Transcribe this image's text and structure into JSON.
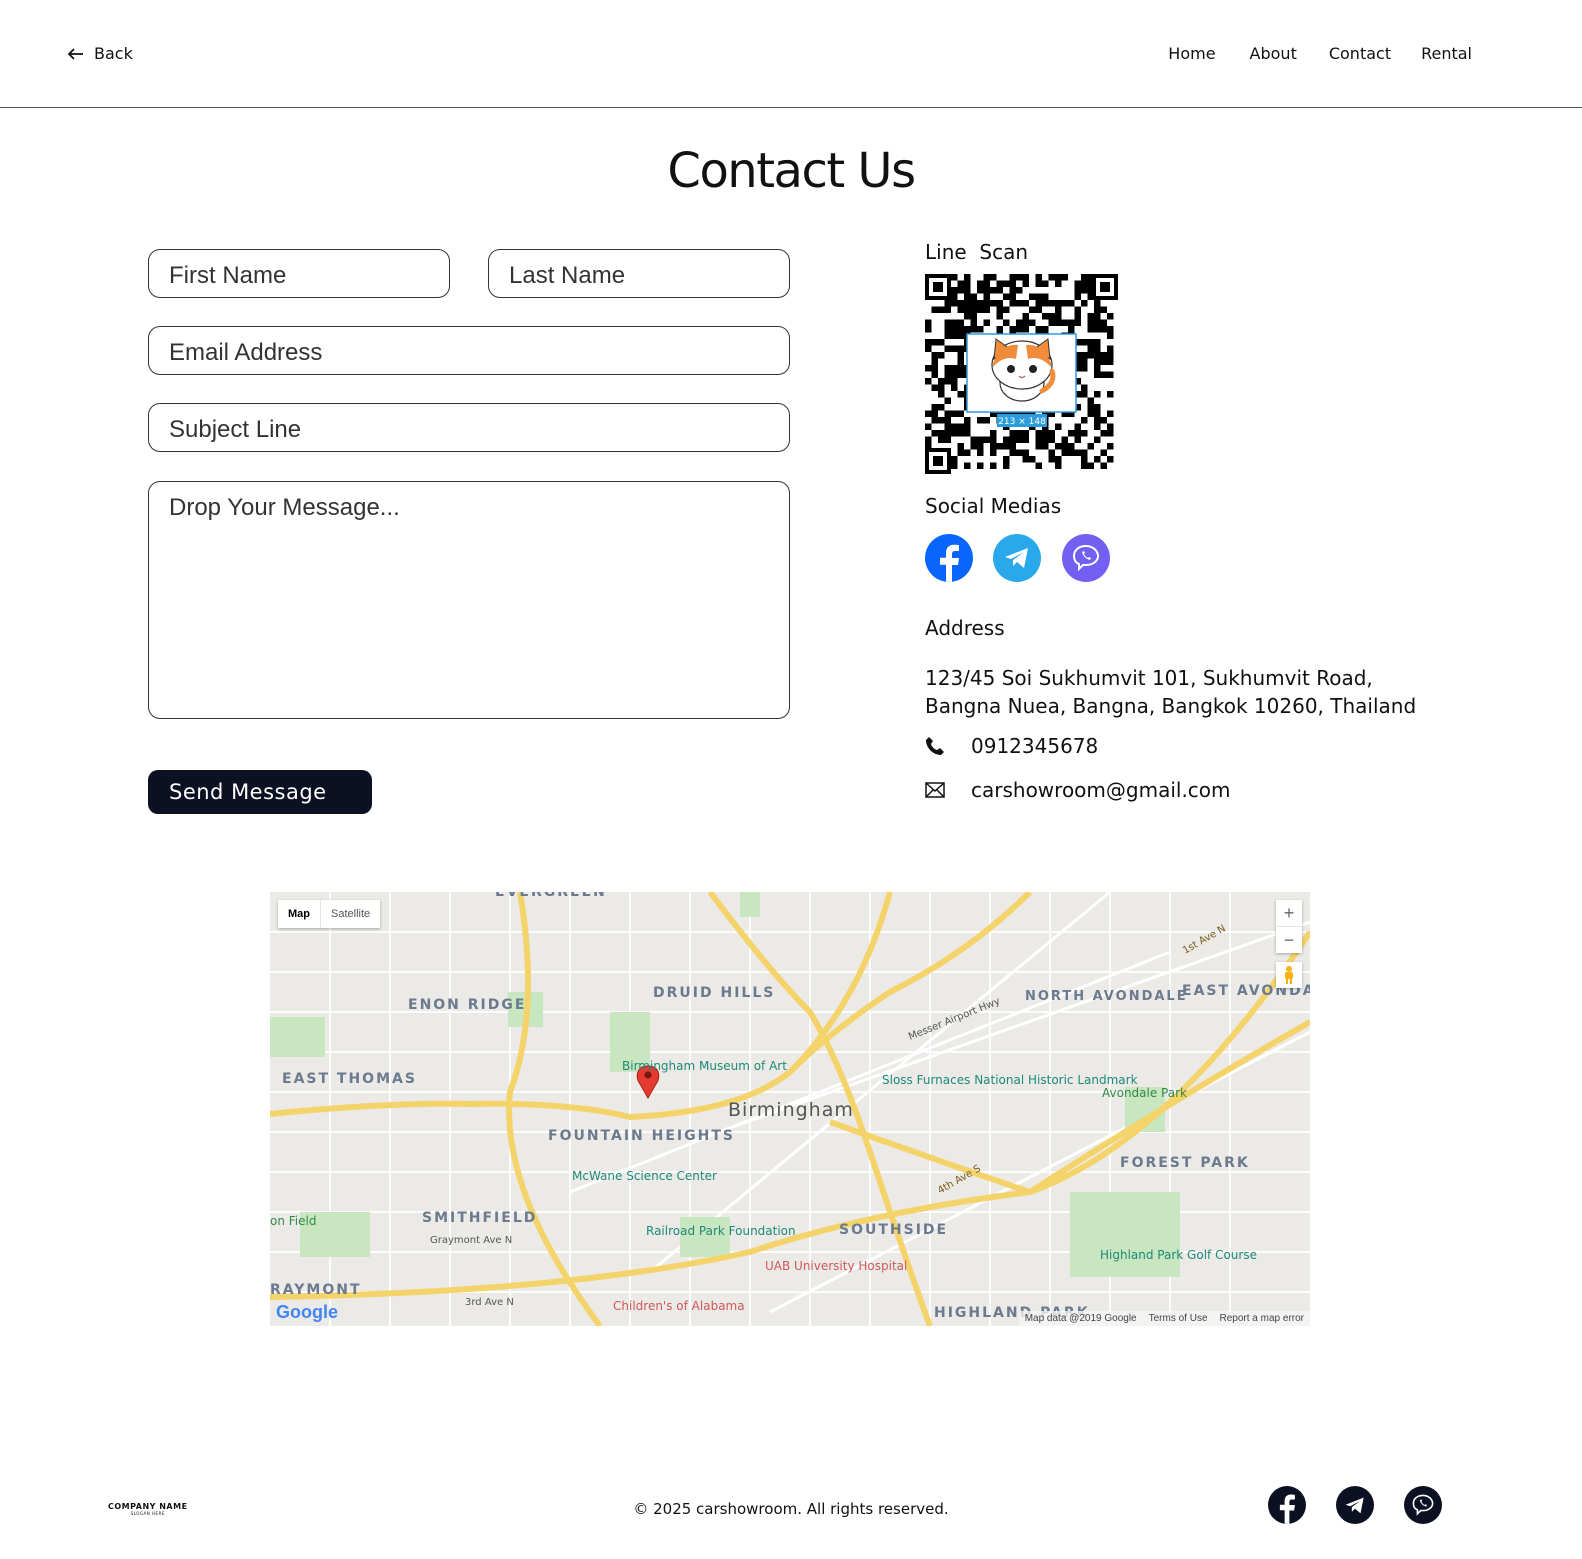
{
  "nav": {
    "back_label": "Back",
    "links": [
      "Home",
      "About",
      "Contact",
      "Rental"
    ]
  },
  "page_title": "Contact Us",
  "form": {
    "first_name_placeholder": "First Name",
    "last_name_placeholder": "Last Name",
    "email_placeholder": "Email Address",
    "subject_placeholder": "Subject Line",
    "message_placeholder": "Drop Your Message...",
    "send_label": "Send Message"
  },
  "line": {
    "label": "Line  Scan",
    "qr_badge": "213 × 148"
  },
  "social": {
    "label": "Social Medias",
    "icons": [
      "facebook-icon",
      "telegram-icon",
      "viber-icon"
    ]
  },
  "address": {
    "label": "Address",
    "line1": "123/45 Soi Sukhumvit 101, Sukhumvit Road,",
    "line2": "Bangna Nuea, Bangna, Bangkok 10260, Thailand",
    "phone": "0912345678",
    "email": "carshowroom@gmail.com"
  },
  "map": {
    "type_map": "Map",
    "type_satellite": "Satellite",
    "zoom_in": "+",
    "zoom_out": "−",
    "city": "Birmingham",
    "labels": {
      "evergreen": "EVERGREEN",
      "druid_hills": "DRUID HILLS",
      "enon_ridge": "ENON RIDGE",
      "north_avondale": "NORTH AVONDALE",
      "east_avondale": "EAST AVONDAL",
      "east_thomas": "EAST THOMAS",
      "museum": "Birmingham Museum of Art",
      "sloss": "Sloss Furnaces National Historic Landmark",
      "avondale_park": "Avondale Park",
      "fountain_heights": "FOUNTAIN HEIGHTS",
      "mcwane": "McWane Science Center",
      "forest_park": "FOREST PARK",
      "smithfield": "SMITHFIELD",
      "graymont_ave": "Graymont Ave N",
      "railroad_park": "Railroad Park Foundation",
      "southside": "SOUTHSIDE",
      "uab": "UAB University Hospital",
      "highland_park_golf": "Highland Park Golf Course",
      "raymont": "RAYMONT",
      "childrens": "Children's of Alabama",
      "highland_park": "HIGHLAND PARK",
      "on_field": "on Field",
      "street_3rd": "3rd Ave N",
      "street_4th": "4th Ave S",
      "street_1st": "1st Ave N",
      "messer": "Messer Airport Hwy"
    },
    "attribution": "Map data @2019 Google",
    "terms": "Terms of Use",
    "report": "Report a map error",
    "logo": "Google"
  },
  "footer": {
    "company_name": "COMPANY NAME",
    "slogan": "SLOGAN HERE",
    "copyright": "© 2025 carshowroom. All rights reserved.",
    "icons": [
      "facebook-icon",
      "telegram-icon",
      "viber-icon"
    ]
  },
  "colors": {
    "accent_dark": "#0b1023",
    "facebook": "#0866ff",
    "telegram": "#29a9eb",
    "viber": "#7360f2"
  }
}
